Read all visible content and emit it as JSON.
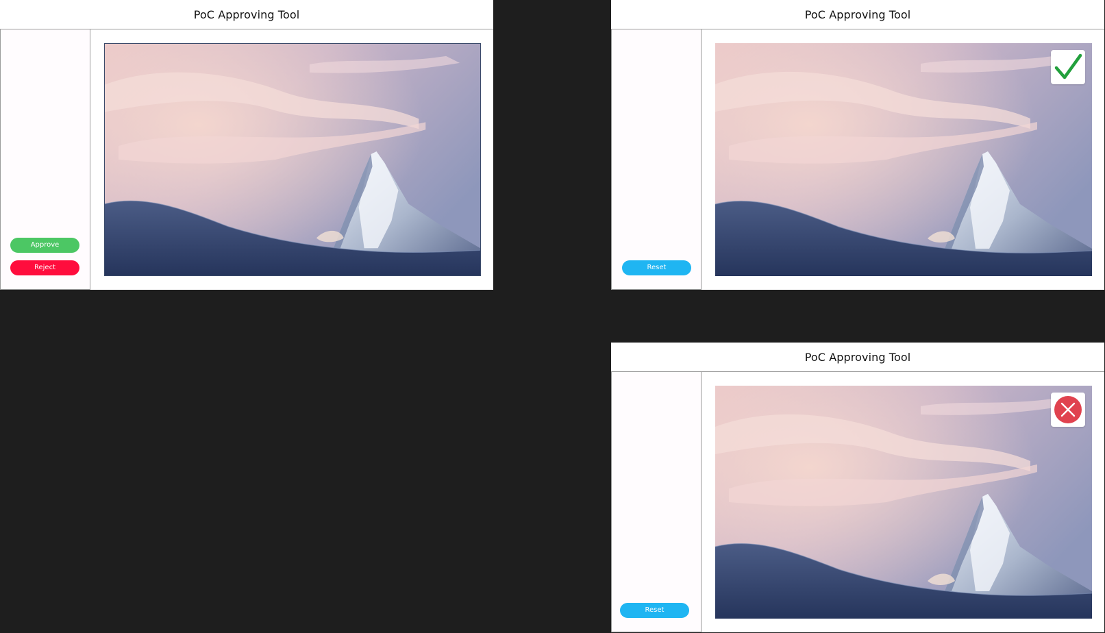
{
  "app_title": "PoC Approving Tool",
  "colors": {
    "canvas": "#1e1e1e",
    "approve": "#4cc764",
    "reject": "#ff0d3d",
    "reset": "#1fb5f2",
    "approved_check": "#22a03c",
    "rejected_circle": "#e0424f"
  },
  "frames": [
    {
      "state": "pending",
      "title": "PoC Approving Tool",
      "approve_label": "Approve",
      "reject_label": "Reject"
    },
    {
      "state": "approved",
      "title": "PoC Approving Tool",
      "reset_label": "Reset",
      "status_icon": "checkmark-icon"
    },
    {
      "state": "rejected",
      "title": "PoC Approving Tool",
      "reset_label": "Reset",
      "status_icon": "x-circle-icon"
    }
  ]
}
